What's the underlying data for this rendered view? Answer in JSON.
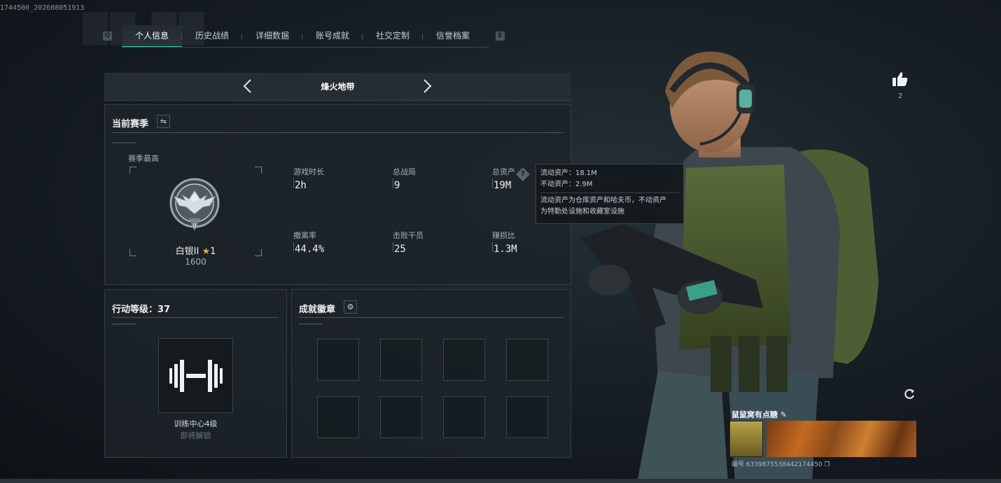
{
  "watermark": "1744500_202608051913",
  "tabs": [
    {
      "label": "个人信息",
      "active": true
    },
    {
      "label": "历史战绩",
      "active": false
    },
    {
      "label": "详细数据",
      "active": false
    },
    {
      "label": "账号成就",
      "active": false
    },
    {
      "label": "社交定制",
      "active": false
    },
    {
      "label": "信誉档案",
      "active": false
    }
  ],
  "mode": {
    "title": "烽火地带"
  },
  "season": {
    "title": "当前赛季",
    "best_label": "赛季最高",
    "rank_name": "白银II",
    "rank_stars": "1",
    "rank_score": "1600",
    "stats": {
      "playtime": {
        "label": "游戏时长",
        "value": "2h"
      },
      "matches": {
        "label": "总战局",
        "value": "9"
      },
      "assets": {
        "label": "总资产",
        "value": "19M"
      },
      "extract_rate": {
        "label": "撤离率",
        "value": "44.4%"
      },
      "kills": {
        "label": "击败干员",
        "value": "25"
      },
      "profit_ratio": {
        "label": "赚损比",
        "value": "1.3M"
      }
    }
  },
  "tooltip": {
    "liquid": "流动资产：18.1M",
    "fixed": "不动资产：2.9M",
    "desc_line1": "流动资产为仓库资产和哈夫币，不动资产",
    "desc_line2": "为特勤处设施和收藏室设施"
  },
  "level": {
    "title": "行动等级：37",
    "name": "训练中心4级",
    "sub": "即将解锁"
  },
  "badges": {
    "title": "成就徽章",
    "slots": 8
  },
  "like": {
    "count": "2"
  },
  "card": {
    "name": "鼠鼠窝有点糖",
    "id_text": "编号 6339875538442174450"
  },
  "colors": {
    "accent": "#3ec89a",
    "gold_star": "#d4b24a"
  }
}
